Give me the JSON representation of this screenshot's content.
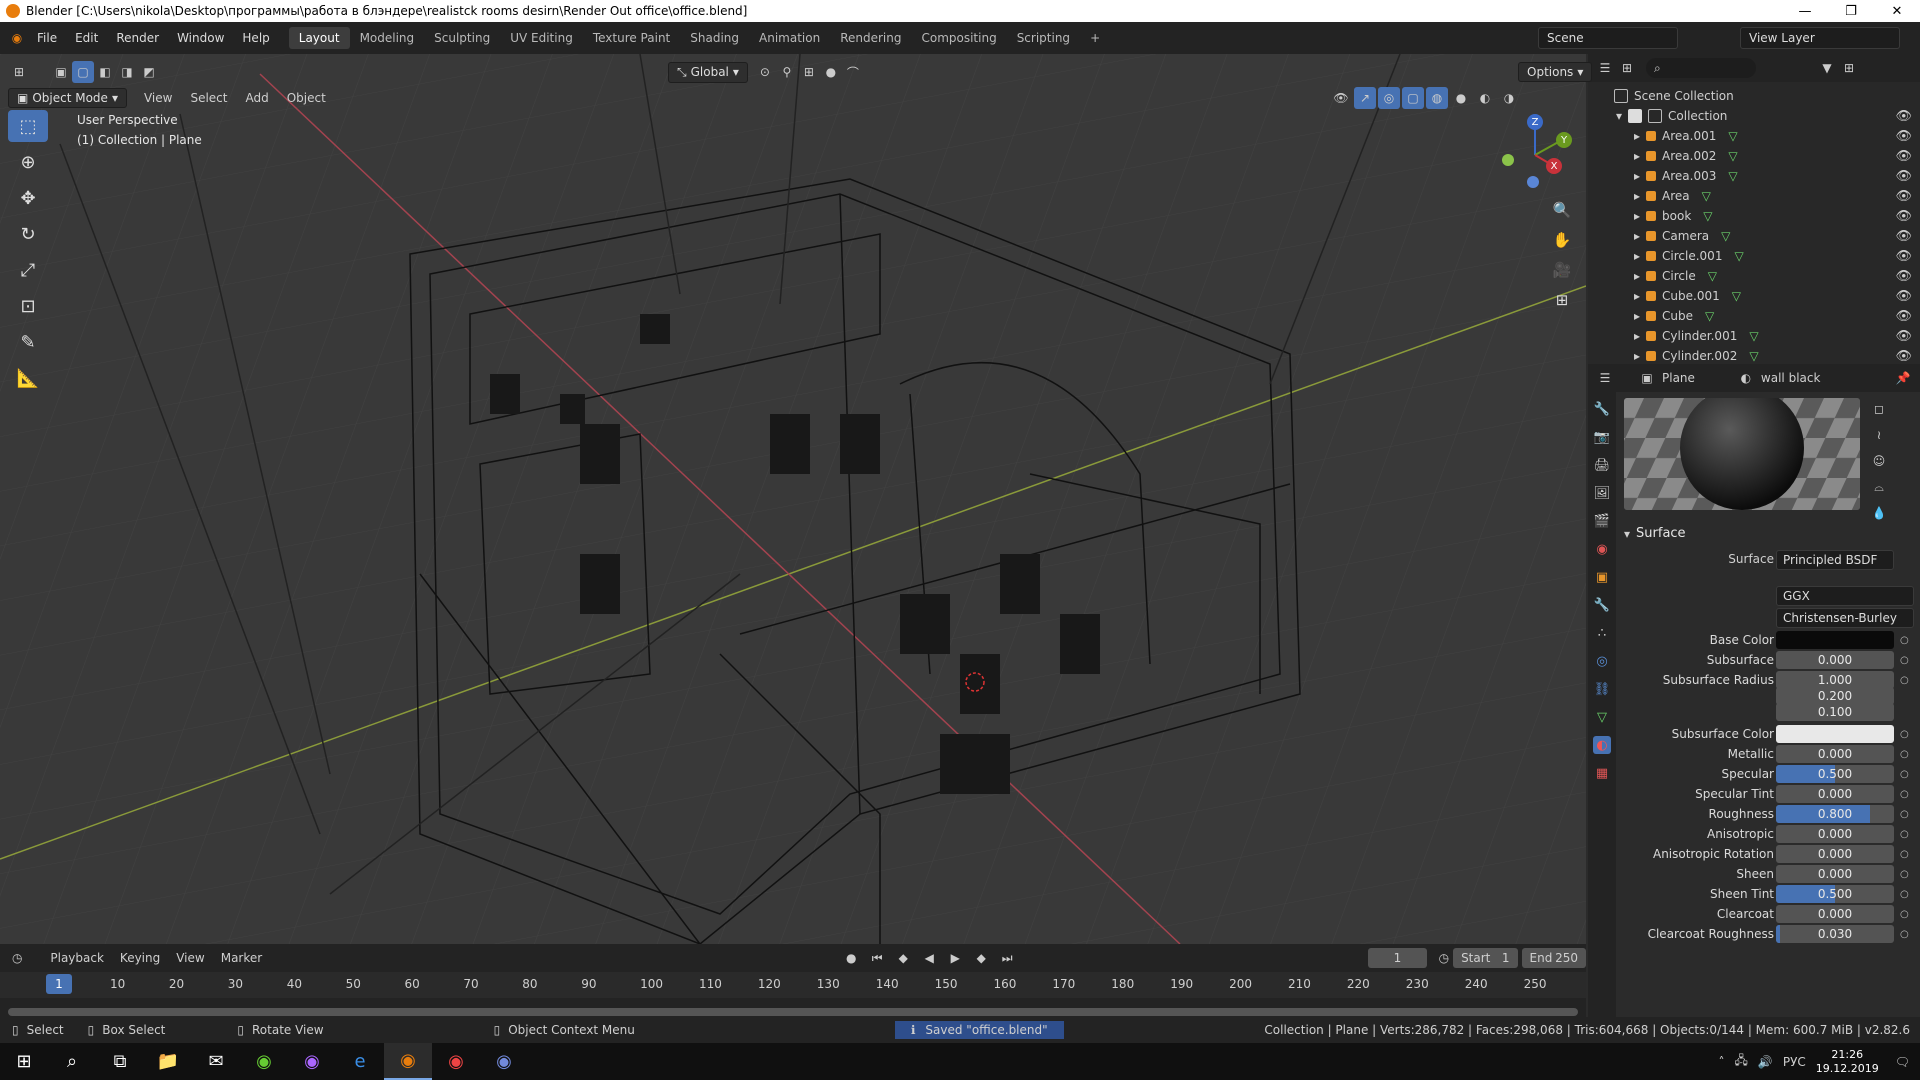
{
  "title_bar": {
    "text": "Blender [C:\\Users\\nikola\\Desktop\\программы\\работа в блэндере\\realistck rooms desirn\\Render Out office\\office.blend]"
  },
  "menu": [
    "File",
    "Edit",
    "Render",
    "Window",
    "Help"
  ],
  "workspaces": [
    "Layout",
    "Modeling",
    "Sculpting",
    "UV Editing",
    "Texture Paint",
    "Shading",
    "Animation",
    "Rendering",
    "Compositing",
    "Scripting",
    "+"
  ],
  "active_workspace": "Layout",
  "scene": "Scene",
  "view_layer": "View Layer",
  "viewport": {
    "mode": "Object Mode",
    "menus": [
      "View",
      "Select",
      "Add",
      "Object"
    ],
    "orientation": "Global",
    "options": "Options",
    "perspective": "User Perspective",
    "collection_info": "(1) Collection | Plane"
  },
  "gizmo": {
    "x": "X",
    "y": "Y",
    "z": "Z"
  },
  "outliner": {
    "root": "Scene Collection",
    "collection": "Collection",
    "items": [
      "Area.001",
      "Area.002",
      "Area.003",
      "Area",
      "book",
      "Camera",
      "Circle.001",
      "Circle",
      "Cube.001",
      "Cube",
      "Cylinder.001",
      "Cylinder.002"
    ]
  },
  "properties": {
    "object": "Plane",
    "material": "wall black",
    "panel": "Surface",
    "surface_label": "Surface",
    "surface_value": "Principled BSDF",
    "distribution": "GGX",
    "subsurface_method": "Christensen-Burley",
    "rows": [
      {
        "label": "Base Color",
        "value": "",
        "kind": "color",
        "color": "#0a0a0a"
      },
      {
        "label": "Subsurface",
        "value": "0.000",
        "fill": 0
      },
      {
        "label": "Subsurface Radius",
        "value": "1.000",
        "fill": 0
      },
      {
        "label": "",
        "value": "0.200",
        "fill": 0
      },
      {
        "label": "",
        "value": "0.100",
        "fill": 0
      },
      {
        "label": "Subsurface Color",
        "value": "",
        "kind": "color",
        "color": "#e8e8e8"
      },
      {
        "label": "Metallic",
        "value": "0.000",
        "fill": 0
      },
      {
        "label": "Specular",
        "value": "0.500",
        "fill": 0.5
      },
      {
        "label": "Specular Tint",
        "value": "0.000",
        "fill": 0
      },
      {
        "label": "Roughness",
        "value": "0.800",
        "fill": 0.8
      },
      {
        "label": "Anisotropic",
        "value": "0.000",
        "fill": 0
      },
      {
        "label": "Anisotropic Rotation",
        "value": "0.000",
        "fill": 0
      },
      {
        "label": "Sheen",
        "value": "0.000",
        "fill": 0
      },
      {
        "label": "Sheen Tint",
        "value": "0.500",
        "fill": 0.5
      },
      {
        "label": "Clearcoat",
        "value": "0.000",
        "fill": 0
      },
      {
        "label": "Clearcoat Roughness",
        "value": "0.030",
        "fill": 0.03
      }
    ]
  },
  "timeline": {
    "menus": [
      "Playback",
      "Keying",
      "View",
      "Marker"
    ],
    "current_frame": "1",
    "start_label": "Start",
    "start": "1",
    "end_label": "End",
    "end": "250",
    "ticks": [
      "1",
      "10",
      "20",
      "30",
      "40",
      "50",
      "60",
      "70",
      "80",
      "90",
      "100",
      "110",
      "120",
      "130",
      "140",
      "150",
      "160",
      "170",
      "180",
      "190",
      "200",
      "210",
      "220",
      "230",
      "240",
      "250"
    ]
  },
  "status": {
    "select": "Select",
    "box_select": "Box Select",
    "rotate": "Rotate View",
    "context": "Object Context Menu",
    "saved": "Saved \"office.blend\"",
    "stats": "Collection | Plane | Verts:286,782 | Faces:298,068 | Tris:604,668 | Objects:0/144 | Mem: 600.7 MiB | v2.82.6"
  },
  "taskbar": {
    "lang": "РУС",
    "time": "21:26",
    "date": "19.12.2019"
  }
}
